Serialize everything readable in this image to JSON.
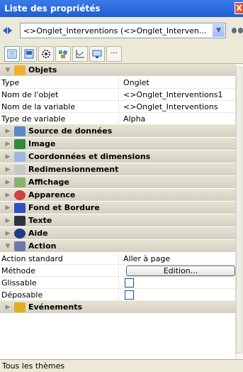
{
  "window": {
    "title": "Liste des propriétés",
    "close_symbol": "X"
  },
  "selector": {
    "value": "<>Onglet_Interventions (<>Onglet_Interven...",
    "dropdown_glyph": "v"
  },
  "tabs": [
    "list-icon",
    "form-icon",
    "gear-icon",
    "shapes-icon",
    "chart-icon",
    "monitor-icon",
    "more-icon"
  ],
  "tab_more_label": "···",
  "sections": {
    "objets": {
      "label": "Objets",
      "properties": [
        {
          "name": "Type",
          "value": "Onglet"
        },
        {
          "name": "Nom de l'objet",
          "value": "<>Onglet_Interventions1"
        },
        {
          "name": "Nom de la variable",
          "value": "<>Onglet_Interventions"
        },
        {
          "name": "Type de variable",
          "value": "Alpha"
        }
      ]
    },
    "collapsed": [
      "Source de données",
      "Image",
      "Coordonnées et dimensions",
      "Redimensionnement",
      "Affichage",
      "Apparence",
      "Fond et Bordure",
      "Texte",
      "Aide"
    ],
    "action": {
      "label": "Action",
      "properties": [
        {
          "name": "Action standard",
          "value": "Aller à page"
        },
        {
          "name": "Méthode",
          "button_label": "Edition..."
        },
        {
          "name": "Glissable",
          "checked": false
        },
        {
          "name": "Déposable",
          "checked": false
        }
      ]
    },
    "evenements": {
      "label": "Evénements"
    }
  },
  "status": {
    "text": "Tous les thèmes"
  },
  "colors": {
    "titlebar": "#2a63d8",
    "section": "#dcd8c8",
    "accent": "#2a63c5"
  }
}
